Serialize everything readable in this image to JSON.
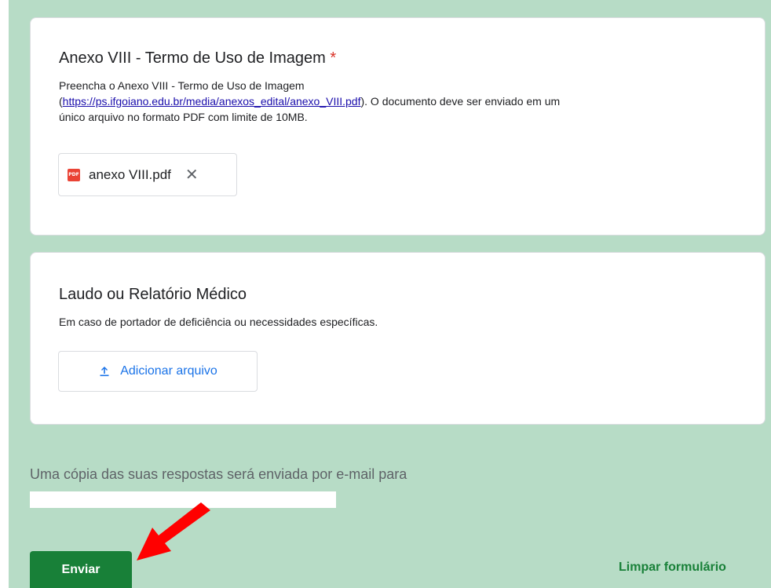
{
  "question1": {
    "title": "Anexo VIII - Termo de Uso de Imagem",
    "required_mark": "*",
    "desc_line1": "Preencha o Anexo VIII - Termo de Uso de Imagem",
    "desc_paren_open": "(",
    "desc_link": "https://ps.ifgoiano.edu.br/media/anexos_edital/anexo_VIII.pdf",
    "desc_after_link": "). O documento deve ser enviado em um",
    "desc_line3": "único arquivo no formato PDF com limite de 10MB.",
    "file": {
      "icon": "pdf-icon",
      "icon_text": "PDF",
      "name": "anexo VIII.pdf",
      "remove_symbol": "✕"
    }
  },
  "question2": {
    "title": "Laudo ou Relatório Médico",
    "desc": "Em caso de portador de deficiência ou necessidades específicas.",
    "upload_label": "Adicionar arquivo",
    "upload_icon": "upload-icon"
  },
  "footer": {
    "copy_note": "Uma cópia das suas respostas será enviada por e-mail para",
    "submit_label": "Enviar",
    "clear_label": "Limpar formulário"
  },
  "colors": {
    "background": "#b7dcc6",
    "submit": "#188038",
    "link": "#1a0dab",
    "accent_blue": "#1a73e8",
    "required": "#d93025",
    "arrow": "#ff0000"
  }
}
